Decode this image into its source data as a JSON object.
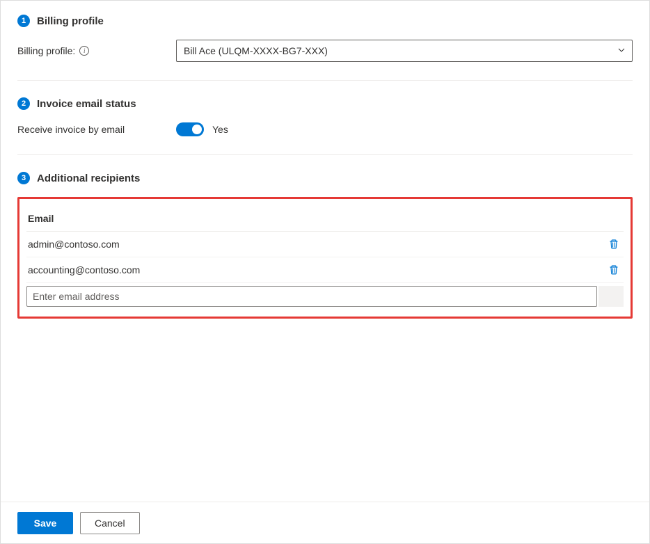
{
  "sections": {
    "billing_profile": {
      "step": "1",
      "title": "Billing profile",
      "field_label": "Billing profile:",
      "selected": "Bill Ace (ULQM-XXXX-BG7-XXX)"
    },
    "invoice_status": {
      "step": "2",
      "title": "Invoice email status",
      "field_label": "Receive invoice by email",
      "toggle_value": "Yes"
    },
    "additional_recipients": {
      "step": "3",
      "title": "Additional recipients",
      "column_header": "Email",
      "rows": [
        "admin@contoso.com",
        "accounting@contoso.com"
      ],
      "input_placeholder": "Enter email address"
    }
  },
  "footer": {
    "save": "Save",
    "cancel": "Cancel"
  }
}
